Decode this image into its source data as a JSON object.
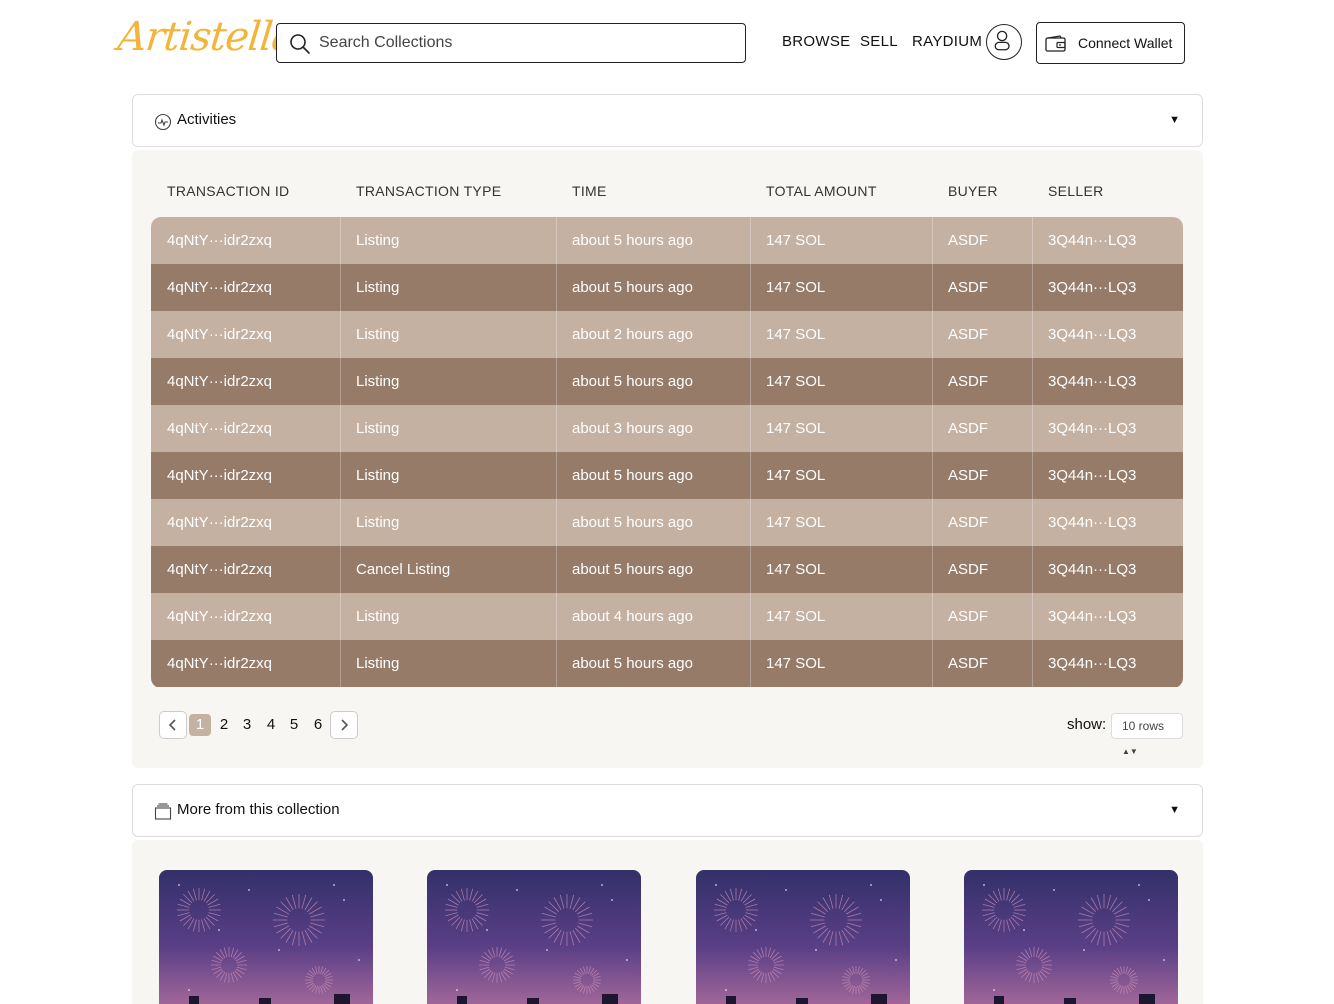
{
  "header": {
    "logo": "Artistella",
    "search_placeholder": "Search Collections",
    "nav": [
      "BROWSE",
      "SELL",
      "RAYDIUM"
    ],
    "connect_wallet": "Connect Wallet"
  },
  "activities": {
    "title": "Activities",
    "columns": [
      "TRANSACTION ID",
      "TRANSACTION TYPE",
      "TIME",
      "TOTAL AMOUNT",
      "BUYER",
      "SELLER"
    ],
    "rows": [
      [
        "4qNtY···idr2zxq",
        "Listing",
        "about 5 hours ago",
        "147 SOL",
        "ASDF",
        "3Q44n···LQ3"
      ],
      [
        "4qNtY···idr2zxq",
        "Listing",
        "about 5 hours ago",
        "147 SOL",
        "ASDF",
        "3Q44n···LQ3"
      ],
      [
        "4qNtY···idr2zxq",
        "Listing",
        "about 2 hours ago",
        "147 SOL",
        "ASDF",
        "3Q44n···LQ3"
      ],
      [
        "4qNtY···idr2zxq",
        "Listing",
        "about 5 hours ago",
        "147 SOL",
        "ASDF",
        "3Q44n···LQ3"
      ],
      [
        "4qNtY···idr2zxq",
        "Listing",
        "about 3 hours ago",
        "147 SOL",
        "ASDF",
        "3Q44n···LQ3"
      ],
      [
        "4qNtY···idr2zxq",
        "Listing",
        "about 5 hours ago",
        "147 SOL",
        "ASDF",
        "3Q44n···LQ3"
      ],
      [
        "4qNtY···idr2zxq",
        "Listing",
        "about 5 hours ago",
        "147 SOL",
        "ASDF",
        "3Q44n···LQ3"
      ],
      [
        "4qNtY···idr2zxq",
        "Cancel Listing",
        "about 5 hours ago",
        "147 SOL",
        "ASDF",
        "3Q44n···LQ3"
      ],
      [
        "4qNtY···idr2zxq",
        "Listing",
        "about 4 hours ago",
        "147 SOL",
        "ASDF",
        "3Q44n···LQ3"
      ],
      [
        "4qNtY···idr2zxq",
        "Listing",
        "about 5 hours ago",
        "147 SOL",
        "ASDF",
        "3Q44n···LQ3"
      ]
    ],
    "pagination": {
      "pages": [
        "1",
        "2",
        "3",
        "4",
        "5",
        "6"
      ],
      "current": "1",
      "show_label": "show:",
      "rows_option": "10 rows"
    }
  },
  "collection": {
    "title": "More from this collection",
    "card_count": 4
  },
  "colors": {
    "row_light": "#c4b1a2",
    "row_dark": "#957b68",
    "logo": "#f2b53a",
    "panel_bg": "#f8f6f2"
  }
}
